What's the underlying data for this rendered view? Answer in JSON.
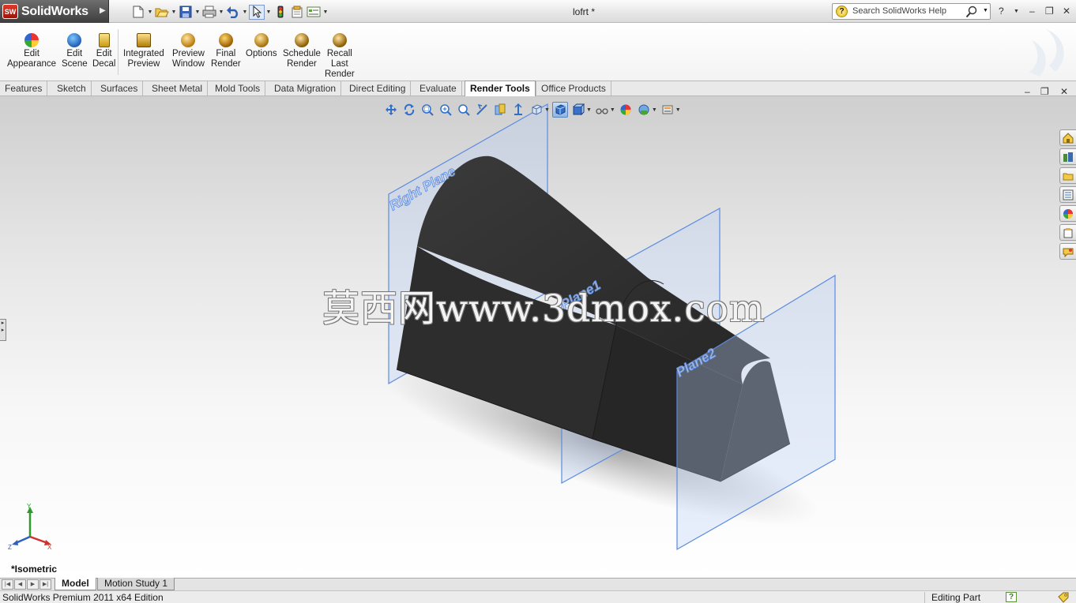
{
  "app": {
    "name": "SolidWorks",
    "badge": "SW",
    "document_title": "lofrt *"
  },
  "search": {
    "placeholder": "Search SolidWorks Help"
  },
  "ribbon": {
    "buttons": [
      {
        "line1": "Edit",
        "line2": "Appearance",
        "line3": ""
      },
      {
        "line1": "Edit",
        "line2": "Scene",
        "line3": ""
      },
      {
        "line1": "Edit",
        "line2": "Decal",
        "line3": ""
      },
      {
        "line1": "Integrated",
        "line2": "Preview",
        "line3": ""
      },
      {
        "line1": "Preview",
        "line2": "Window",
        "line3": ""
      },
      {
        "line1": "Final",
        "line2": "Render",
        "line3": ""
      },
      {
        "line1": "Options",
        "line2": "",
        "line3": ""
      },
      {
        "line1": "Schedule",
        "line2": "Render",
        "line3": ""
      },
      {
        "line1": "Recall",
        "line2": "Last",
        "line3": "Render"
      }
    ]
  },
  "command_tabs": [
    "Features",
    "Sketch",
    "Surfaces",
    "Sheet Metal",
    "Mold Tools",
    "Data Migration",
    "Direct Editing",
    "Evaluate",
    "Render Tools",
    "Office Products"
  ],
  "active_command_tab": "Render Tools",
  "viewport": {
    "planes": {
      "right": "Right Plane",
      "plane1": "Plane1",
      "plane2": "Plane2"
    },
    "watermark": "莫西网www.3dmox.com",
    "triad": {
      "x": "X",
      "y": "Y",
      "z": "Z"
    },
    "view_orientation": "*Isometric"
  },
  "model_tabs": {
    "model": "Model",
    "motion": "Motion Study 1"
  },
  "status": {
    "left": "SolidWorks Premium 2011 x64 Edition",
    "mode": "Editing Part",
    "help_glyph": "?"
  },
  "colors": {
    "accent_red": "#c8261a",
    "plane_blue": "#4f7fdc",
    "body_black": "#2b2b2b"
  }
}
